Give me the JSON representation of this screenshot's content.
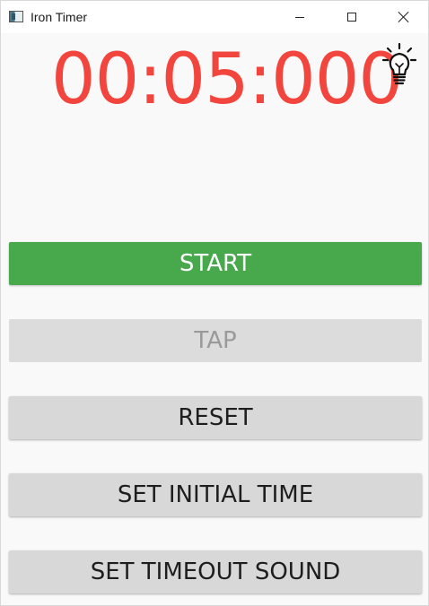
{
  "window": {
    "title": "Iron Timer",
    "controls": {
      "minimize_icon": "minimize-icon",
      "maximize_icon": "maximize-icon",
      "close_icon": "close-icon"
    }
  },
  "timer": {
    "display": "00:05:000",
    "color": "#f2453d",
    "theme_toggle_icon": "lightbulb-icon"
  },
  "buttons": {
    "start": {
      "label": "START",
      "background": "#47a84c",
      "enabled": true
    },
    "tap": {
      "label": "TAP",
      "background": "#dcdcdc",
      "enabled": false
    },
    "reset": {
      "label": "RESET",
      "background": "#d8d8d8",
      "enabled": true
    },
    "set_initial_time": {
      "label": "SET INITIAL TIME",
      "background": "#d8d8d8",
      "enabled": true
    },
    "set_timeout_sound": {
      "label": "SET TIMEOUT SOUND",
      "background": "#d8d8d8",
      "enabled": true
    }
  }
}
